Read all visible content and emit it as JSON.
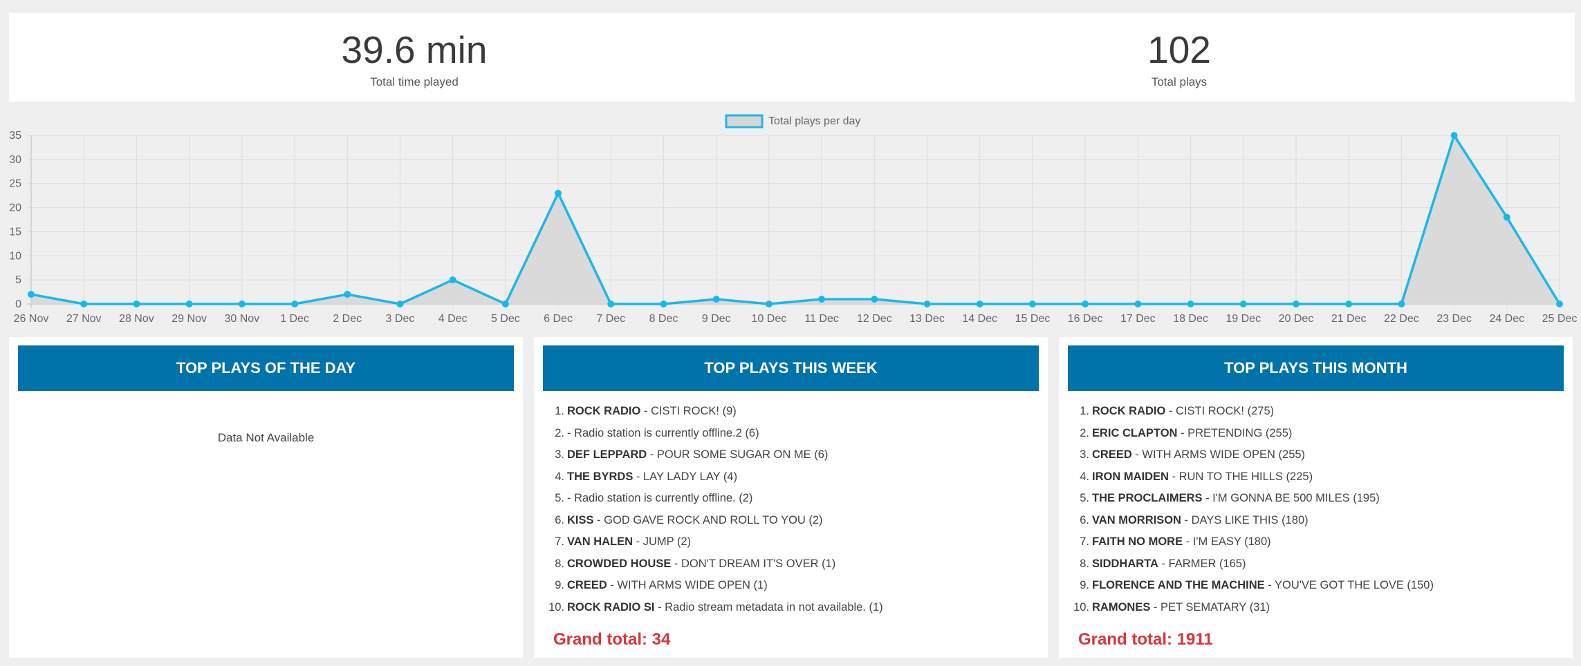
{
  "stats": {
    "time_value": "39.6 min",
    "time_label": "Total time played",
    "plays_value": "102",
    "plays_label": "Total plays"
  },
  "chart_data": {
    "type": "line",
    "legend": "Total plays per day",
    "legend_position": "top-center",
    "categories": [
      "26 Nov",
      "27 Nov",
      "28 Nov",
      "29 Nov",
      "30 Nov",
      "1 Dec",
      "2 Dec",
      "3 Dec",
      "4 Dec",
      "5 Dec",
      "6 Dec",
      "7 Dec",
      "8 Dec",
      "9 Dec",
      "10 Dec",
      "11 Dec",
      "12 Dec",
      "13 Dec",
      "14 Dec",
      "15 Dec",
      "16 Dec",
      "17 Dec",
      "18 Dec",
      "19 Dec",
      "20 Dec",
      "21 Dec",
      "22 Dec",
      "23 Dec",
      "24 Dec",
      "25 Dec"
    ],
    "series": [
      {
        "name": "Total plays per day",
        "values": [
          2,
          0,
          0,
          0,
          0,
          0,
          2,
          0,
          5,
          0,
          23,
          0,
          0,
          1,
          0,
          1,
          1,
          0,
          0,
          0,
          0,
          0,
          0,
          0,
          0,
          0,
          0,
          35,
          18,
          0
        ]
      }
    ],
    "ylim": [
      0,
      35
    ],
    "yticks": [
      "0",
      "5",
      "10",
      "15",
      "20",
      "25",
      "30",
      "35"
    ],
    "grid": true,
    "colors": {
      "line": "#1ab8e8",
      "fill": "#d6d6d6"
    }
  },
  "cards": {
    "day": {
      "title": "TOP PLAYS OF THE DAY",
      "empty": "Data Not Available"
    },
    "week": {
      "title": "TOP PLAYS THIS WEEK",
      "items": [
        {
          "num": "1.",
          "artist": "ROCK RADIO",
          "rest": " - CISTI ROCK! (9)"
        },
        {
          "num": "2.",
          "artist": "",
          "rest": "- Radio station is currently offline.2 (6)"
        },
        {
          "num": "3.",
          "artist": "DEF LEPPARD",
          "rest": " - POUR SOME SUGAR ON ME (6)"
        },
        {
          "num": "4.",
          "artist": "THE BYRDS",
          "rest": " - LAY LADY LAY (4)"
        },
        {
          "num": "5.",
          "artist": "",
          "rest": "- Radio station is currently offline. (2)"
        },
        {
          "num": "6.",
          "artist": "KISS",
          "rest": " - GOD GAVE ROCK AND ROLL TO YOU (2)"
        },
        {
          "num": "7.",
          "artist": "VAN HALEN",
          "rest": " - JUMP (2)"
        },
        {
          "num": "8.",
          "artist": "CROWDED HOUSE",
          "rest": " - DON'T DREAM IT'S OVER (1)"
        },
        {
          "num": "9.",
          "artist": "CREED",
          "rest": " - WITH ARMS WIDE OPEN (1)"
        },
        {
          "num": "10.",
          "artist": "ROCK RADIO SI",
          "rest": " - Radio stream metadata in not available. (1)"
        }
      ],
      "grand_total": "Grand total: 34"
    },
    "month": {
      "title": "TOP PLAYS THIS MONTH",
      "items": [
        {
          "num": "1.",
          "artist": "ROCK RADIO",
          "rest": " - CISTI ROCK! (275)"
        },
        {
          "num": "2.",
          "artist": "ERIC CLAPTON",
          "rest": " - PRETENDING (255)"
        },
        {
          "num": "3.",
          "artist": "CREED",
          "rest": " - WITH ARMS WIDE OPEN (255)"
        },
        {
          "num": "4.",
          "artist": "IRON MAIDEN",
          "rest": " - RUN TO THE HILLS (225)"
        },
        {
          "num": "5.",
          "artist": "THE PROCLAIMERS",
          "rest": " - I'M GONNA BE 500 MILES (195)"
        },
        {
          "num": "6.",
          "artist": "VAN MORRISON",
          "rest": " - DAYS LIKE THIS (180)"
        },
        {
          "num": "7.",
          "artist": "FAITH NO MORE",
          "rest": " - I'M EASY (180)"
        },
        {
          "num": "8.",
          "artist": "SIDDHARTA",
          "rest": " - FARMER (165)"
        },
        {
          "num": "9.",
          "artist": "FLORENCE AND THE MACHINE",
          "rest": " - YOU'VE GOT THE LOVE (150)"
        },
        {
          "num": "10.",
          "artist": "RAMONES",
          "rest": " - PET SEMATARY (31)"
        }
      ],
      "grand_total": "Grand total: 1911"
    }
  }
}
